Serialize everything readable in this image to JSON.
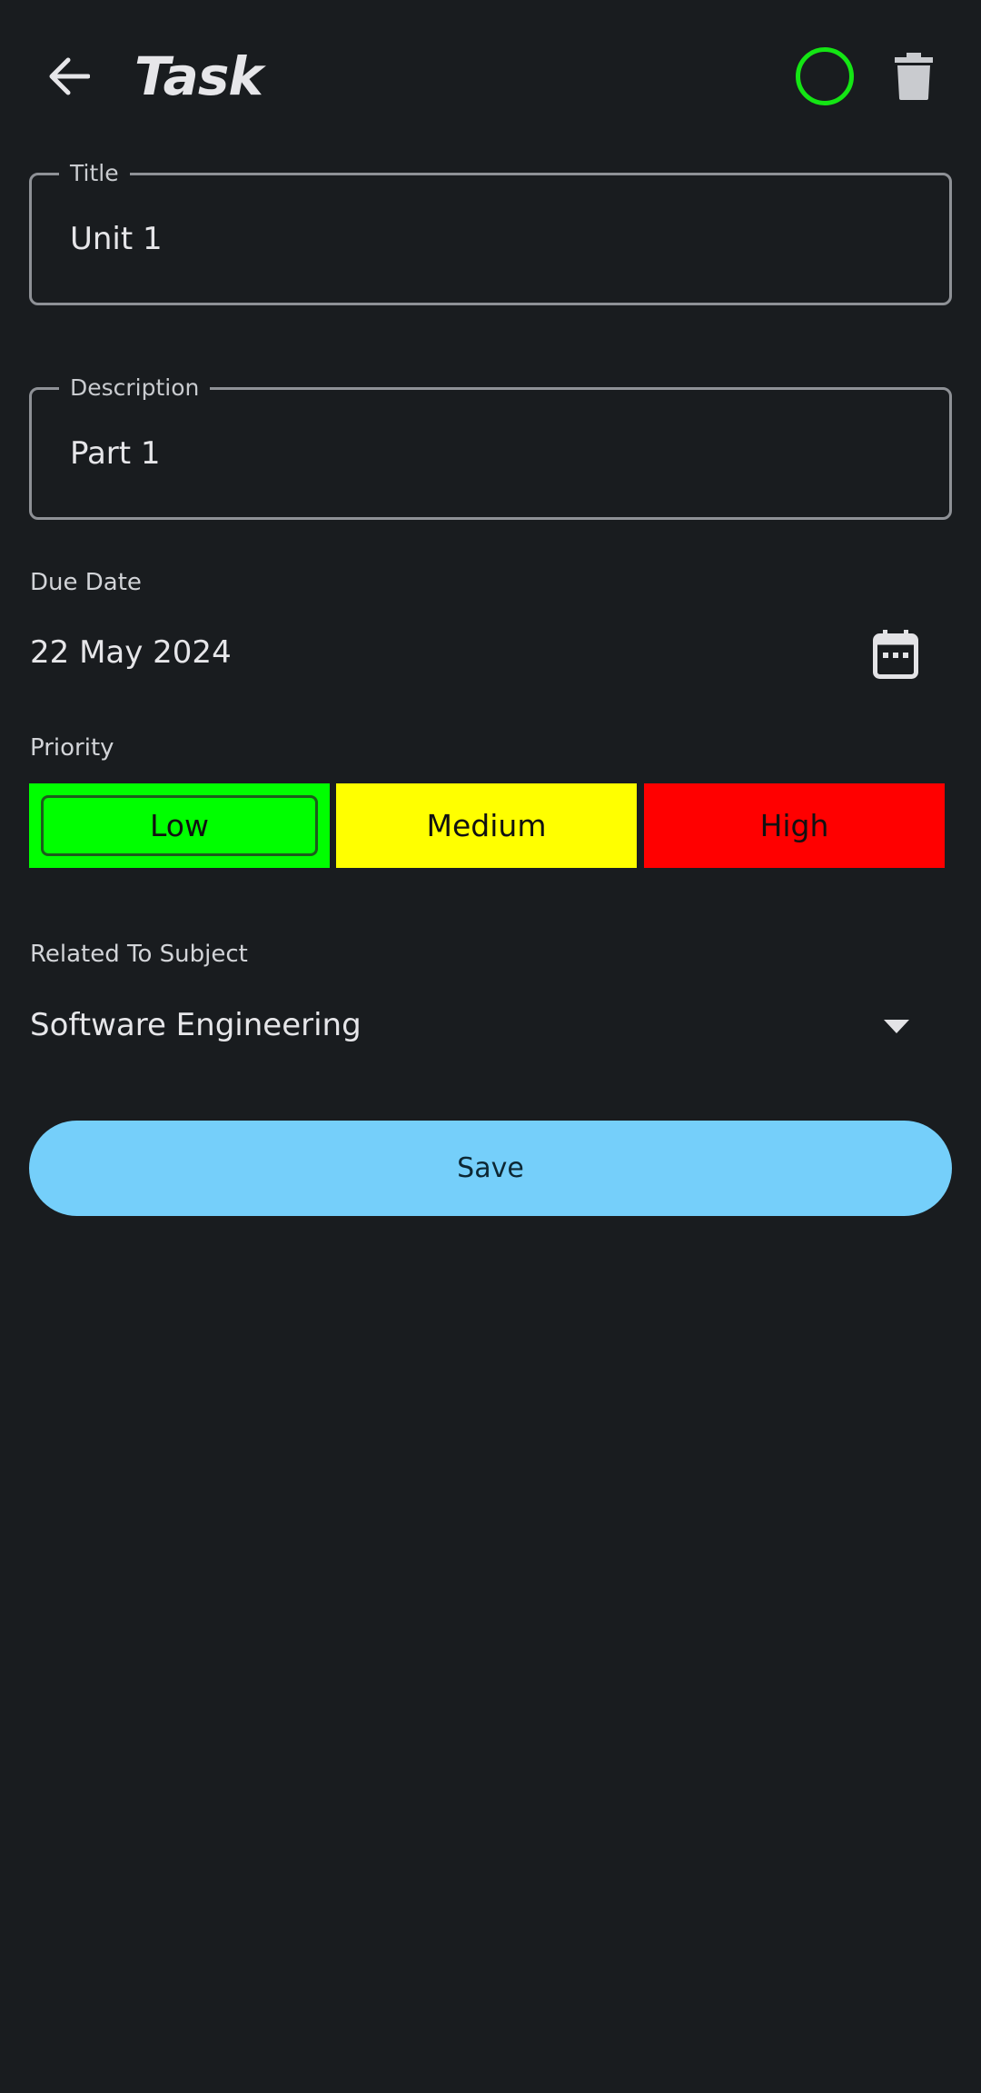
{
  "header": {
    "title": "Task",
    "back_icon": "arrow-left-icon",
    "complete_icon": "circle-outline-icon",
    "delete_icon": "trash-icon",
    "complete_color": "#14e514"
  },
  "form": {
    "title": {
      "label": "Title",
      "value": "Unit 1"
    },
    "description": {
      "label": "Description",
      "value": "Part 1"
    },
    "due_date": {
      "label": "Due Date",
      "value": "22 May 2024",
      "icon": "calendar-icon"
    },
    "priority": {
      "label": "Priority",
      "selected": "Low",
      "options": [
        {
          "label": "Low",
          "color": "#00ff00"
        },
        {
          "label": "Medium",
          "color": "#ffff00"
        },
        {
          "label": "High",
          "color": "#ff0000"
        }
      ]
    },
    "subject": {
      "label": "Related To Subject",
      "value": "Software Engineering",
      "icon": "chevron-down-icon"
    }
  },
  "actions": {
    "save_label": "Save",
    "save_color": "#75cffa"
  }
}
